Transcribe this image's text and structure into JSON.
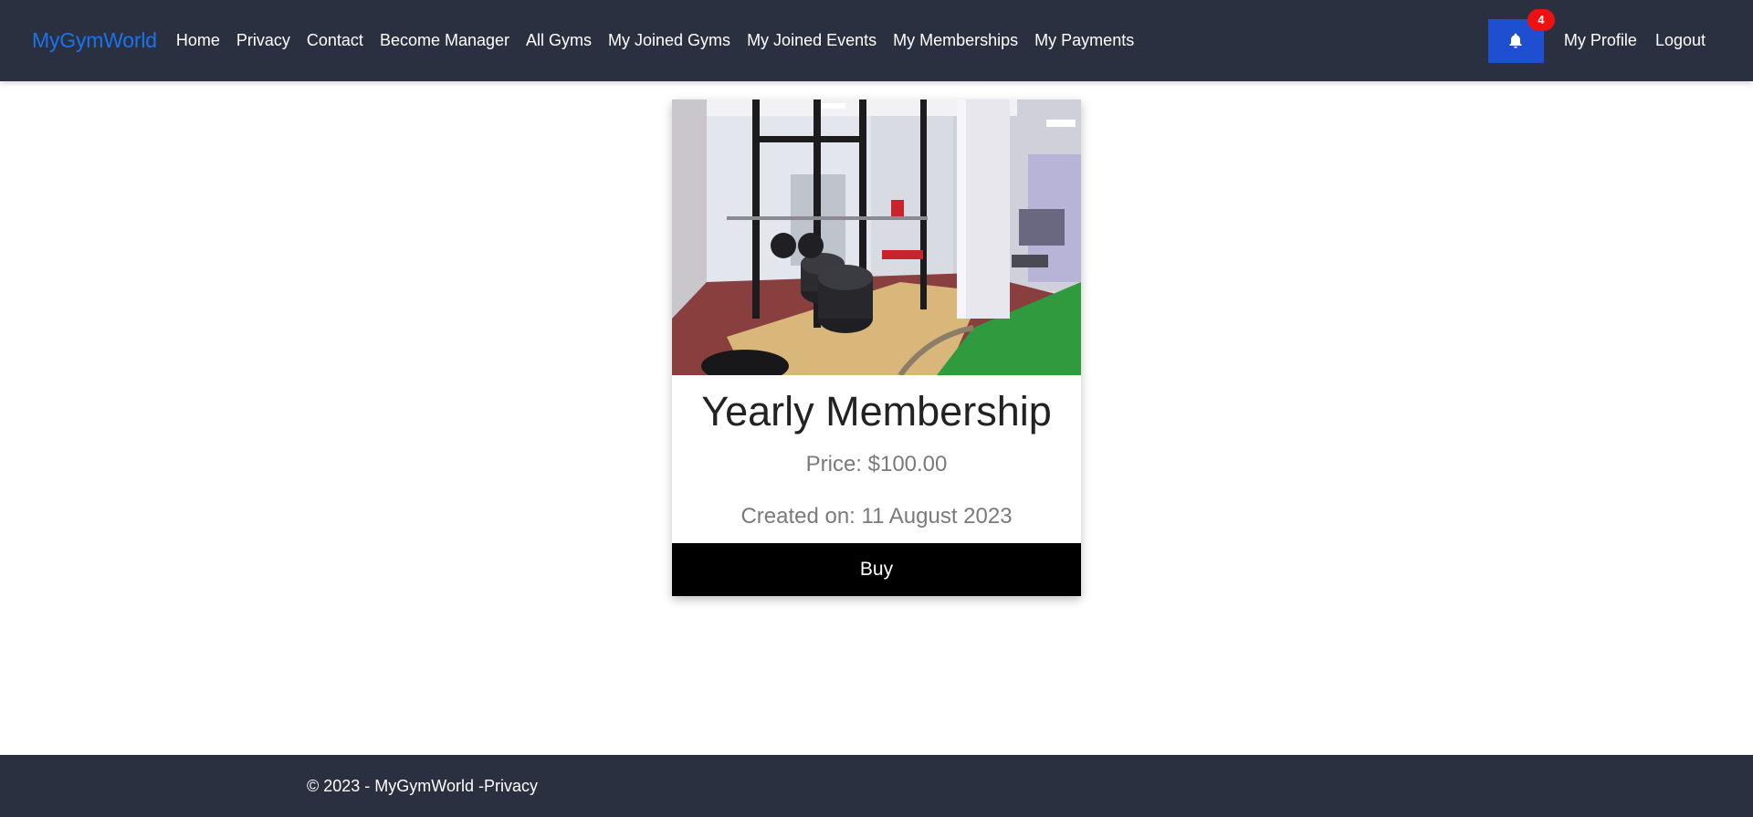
{
  "navbar": {
    "brand": "MyGymWorld",
    "links": [
      "Home",
      "Privacy",
      "Contact",
      "Become Manager",
      "All Gyms",
      "My Joined Gyms",
      "My Joined Events",
      "My Memberships",
      "My Payments"
    ],
    "notification_count": "4",
    "profile_label": "My Profile",
    "logout_label": "Logout"
  },
  "card": {
    "title": "Yearly Membership",
    "price": "Price: $100.00",
    "created": "Created on: 11 August 2023",
    "buy_label": "Buy"
  },
  "footer": {
    "copyright": "© 2023 - MyGymWorld - ",
    "privacy_label": "Privacy"
  },
  "colors": {
    "navbar_bg": "#2b3041",
    "brand": "#1a73e8",
    "bell_button": "#1f4fd1",
    "badge": "#ee1111",
    "buy_button": "#000000"
  }
}
